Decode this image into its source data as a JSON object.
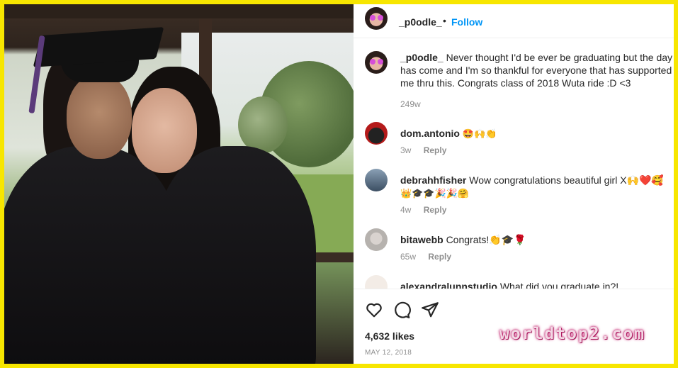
{
  "post": {
    "username": "_p0odle_",
    "separator": "•",
    "follow_label": "Follow",
    "caption": "Never thought I'd be ever be graduating but the day has come and I'm so thankful for everyone that has supported me thru this. Congrats class of 2018 Wuta ride :D <3",
    "caption_time": "249w"
  },
  "comments": [
    {
      "user": "dom.antonio",
      "text": "🤩🙌👏",
      "time": "3w",
      "reply": "Reply"
    },
    {
      "user": "debrahhfisher",
      "text": "Wow congratulations beautiful girl X🙌❤️🥰",
      "text2": "👑🎓🎓🎉🎉🤗",
      "time": "4w",
      "reply": "Reply"
    },
    {
      "user": "bitawebb",
      "text": "Congrats!👏🎓🌹",
      "time": "65w",
      "reply": "Reply"
    },
    {
      "user": "alexandralunnstudio",
      "text": "What did you graduate in?!"
    }
  ],
  "footer": {
    "likes": "4,632 likes",
    "date": "MAY 12, 2018"
  },
  "watermark": "worldtop2.com",
  "icons": {
    "like": "heart-icon",
    "comment": "comment-icon",
    "share": "share-icon"
  },
  "colors": {
    "frame": "#f7e600",
    "follow": "#0095f6",
    "muted": "#8e8e8e"
  }
}
